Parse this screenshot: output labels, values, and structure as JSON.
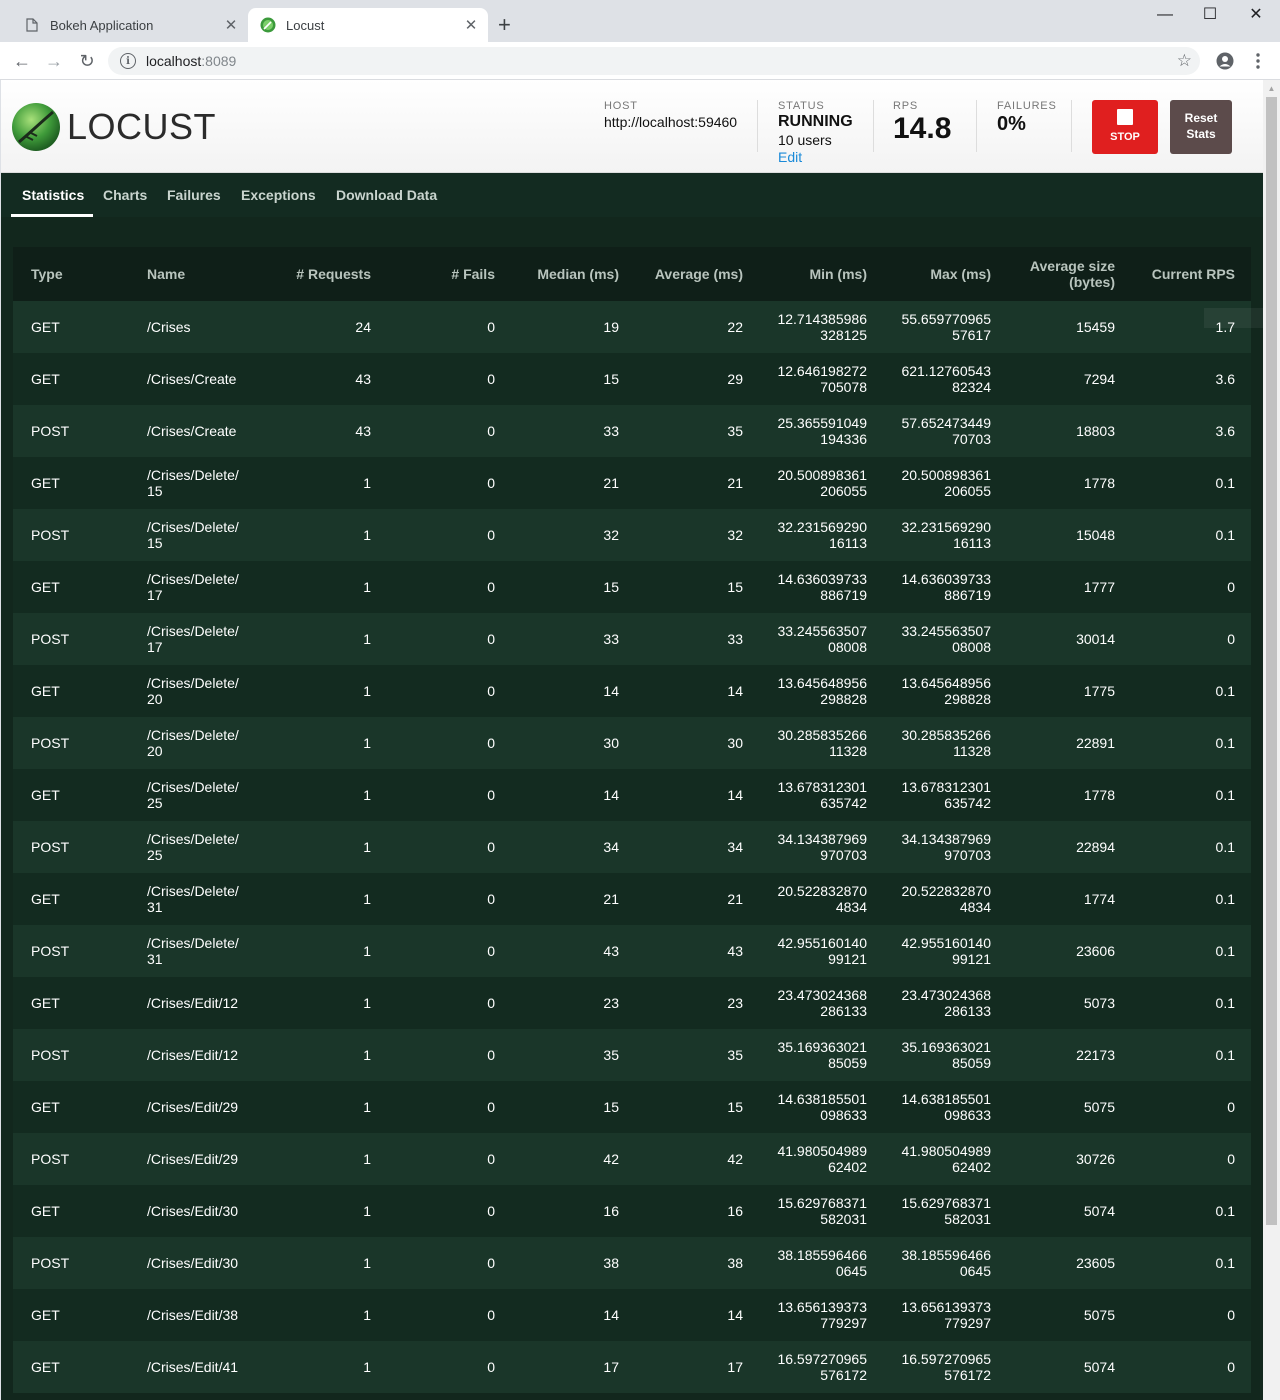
{
  "browser": {
    "tabs": [
      {
        "title": "Bokeh Application",
        "icon": "page-icon"
      },
      {
        "title": "Locust",
        "icon": "locust-favicon"
      }
    ],
    "new_tab": "+",
    "url_host": "localhost",
    "url_port": ":8089",
    "window_controls": {
      "minimize": "—",
      "maximize": "☐",
      "close": "✕"
    }
  },
  "header": {
    "logo_text": "LOCUST",
    "host": {
      "label": "HOST",
      "value": "http://localhost:59460"
    },
    "status": {
      "label": "STATUS",
      "value": "RUNNING",
      "users": "10 users",
      "edit": "Edit"
    },
    "rps": {
      "label": "RPS",
      "value": "14.8"
    },
    "failures": {
      "label": "FAILURES",
      "value": "0%"
    },
    "stop_label": "STOP",
    "reset_label_1": "Reset",
    "reset_label_2": "Stats",
    "colors": {
      "stop": "#e01f1f",
      "reset": "#5c4b4b",
      "edit_link": "#1a8ad8"
    }
  },
  "nav": {
    "items": [
      "Statistics",
      "Charts",
      "Failures",
      "Exceptions",
      "Download Data"
    ],
    "active": "Statistics"
  },
  "table": {
    "columns": [
      "Type",
      "Name",
      "# Requests",
      "# Fails",
      "Median (ms)",
      "Average (ms)",
      "Min (ms)",
      "Max (ms)",
      "Average size (bytes)",
      "Current RPS"
    ],
    "rows": [
      {
        "type": "GET",
        "name": "/Crises",
        "requests": "24",
        "fails": "0",
        "median": "19",
        "average": "22",
        "min": "12.714385986328125",
        "max": "55.65977096557617",
        "size": "15459",
        "rps": "1.7"
      },
      {
        "type": "GET",
        "name": "/Crises/Create",
        "requests": "43",
        "fails": "0",
        "median": "15",
        "average": "29",
        "min": "12.646198272705078",
        "max": "621.1276054382324",
        "size": "7294",
        "rps": "3.6"
      },
      {
        "type": "POST",
        "name": "/Crises/Create",
        "requests": "43",
        "fails": "0",
        "median": "33",
        "average": "35",
        "min": "25.365591049194336",
        "max": "57.65247344970703",
        "size": "18803",
        "rps": "3.6"
      },
      {
        "type": "GET",
        "name": "/Crises/Delete/15",
        "requests": "1",
        "fails": "0",
        "median": "21",
        "average": "21",
        "min": "20.500898361206055",
        "max": "20.500898361206055",
        "size": "1778",
        "rps": "0.1"
      },
      {
        "type": "POST",
        "name": "/Crises/Delete/15",
        "requests": "1",
        "fails": "0",
        "median": "32",
        "average": "32",
        "min": "32.23156929016113",
        "max": "32.23156929016113",
        "size": "15048",
        "rps": "0.1"
      },
      {
        "type": "GET",
        "name": "/Crises/Delete/17",
        "requests": "1",
        "fails": "0",
        "median": "15",
        "average": "15",
        "min": "14.636039733886719",
        "max": "14.636039733886719",
        "size": "1777",
        "rps": "0"
      },
      {
        "type": "POST",
        "name": "/Crises/Delete/17",
        "requests": "1",
        "fails": "0",
        "median": "33",
        "average": "33",
        "min": "33.24556350708008",
        "max": "33.24556350708008",
        "size": "30014",
        "rps": "0"
      },
      {
        "type": "GET",
        "name": "/Crises/Delete/20",
        "requests": "1",
        "fails": "0",
        "median": "14",
        "average": "14",
        "min": "13.645648956298828",
        "max": "13.645648956298828",
        "size": "1775",
        "rps": "0.1"
      },
      {
        "type": "POST",
        "name": "/Crises/Delete/20",
        "requests": "1",
        "fails": "0",
        "median": "30",
        "average": "30",
        "min": "30.28583526611328",
        "max": "30.28583526611328",
        "size": "22891",
        "rps": "0.1"
      },
      {
        "type": "GET",
        "name": "/Crises/Delete/25",
        "requests": "1",
        "fails": "0",
        "median": "14",
        "average": "14",
        "min": "13.678312301635742",
        "max": "13.678312301635742",
        "size": "1778",
        "rps": "0.1"
      },
      {
        "type": "POST",
        "name": "/Crises/Delete/25",
        "requests": "1",
        "fails": "0",
        "median": "34",
        "average": "34",
        "min": "34.134387969970703",
        "max": "34.134387969970703",
        "size": "22894",
        "rps": "0.1"
      },
      {
        "type": "GET",
        "name": "/Crises/Delete/31",
        "requests": "1",
        "fails": "0",
        "median": "21",
        "average": "21",
        "min": "20.5228328704834",
        "max": "20.5228328704834",
        "size": "1774",
        "rps": "0.1"
      },
      {
        "type": "POST",
        "name": "/Crises/Delete/31",
        "requests": "1",
        "fails": "0",
        "median": "43",
        "average": "43",
        "min": "42.95516014099121",
        "max": "42.95516014099121",
        "size": "23606",
        "rps": "0.1"
      },
      {
        "type": "GET",
        "name": "/Crises/Edit/12",
        "requests": "1",
        "fails": "0",
        "median": "23",
        "average": "23",
        "min": "23.473024368286133",
        "max": "23.473024368286133",
        "size": "5073",
        "rps": "0.1"
      },
      {
        "type": "POST",
        "name": "/Crises/Edit/12",
        "requests": "1",
        "fails": "0",
        "median": "35",
        "average": "35",
        "min": "35.16936302185059",
        "max": "35.16936302185059",
        "size": "22173",
        "rps": "0.1"
      },
      {
        "type": "GET",
        "name": "/Crises/Edit/29",
        "requests": "1",
        "fails": "0",
        "median": "15",
        "average": "15",
        "min": "14.638185501098633",
        "max": "14.638185501098633",
        "size": "5075",
        "rps": "0"
      },
      {
        "type": "POST",
        "name": "/Crises/Edit/29",
        "requests": "1",
        "fails": "0",
        "median": "42",
        "average": "42",
        "min": "41.98050498962402",
        "max": "41.98050498962402",
        "size": "30726",
        "rps": "0"
      },
      {
        "type": "GET",
        "name": "/Crises/Edit/30",
        "requests": "1",
        "fails": "0",
        "median": "16",
        "average": "16",
        "min": "15.629768371582031",
        "max": "15.629768371582031",
        "size": "5074",
        "rps": "0.1"
      },
      {
        "type": "POST",
        "name": "/Crises/Edit/30",
        "requests": "1",
        "fails": "0",
        "median": "38",
        "average": "38",
        "min": "38.1855964660645",
        "max": "38.1855964660645",
        "size": "23605",
        "rps": "0.1"
      },
      {
        "type": "GET",
        "name": "/Crises/Edit/38",
        "requests": "1",
        "fails": "0",
        "median": "14",
        "average": "14",
        "min": "13.656139373779297",
        "max": "13.656139373779297",
        "size": "5075",
        "rps": "0"
      },
      {
        "type": "GET",
        "name": "/Crises/Edit/41",
        "requests": "1",
        "fails": "0",
        "median": "17",
        "average": "17",
        "min": "16.597270965576172",
        "max": "16.597270965576172",
        "size": "5074",
        "rps": "0"
      }
    ]
  }
}
